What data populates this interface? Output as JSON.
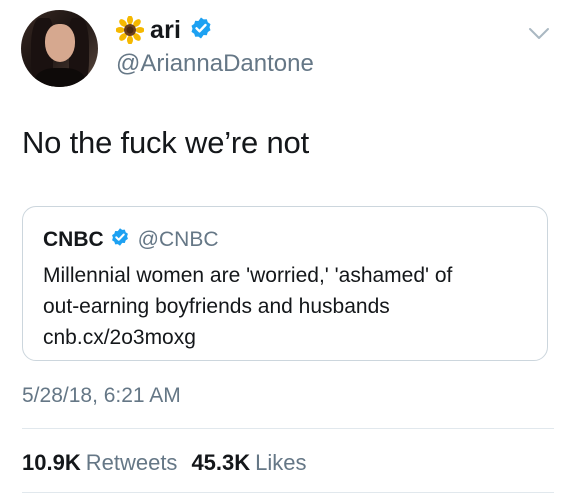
{
  "author": {
    "display_name": "ari",
    "handle": "@AriannaDantone",
    "name_emoji": "sunflower-icon",
    "verified": true
  },
  "tweet": {
    "text": "No the fuck we’re not",
    "timestamp": "5/28/18, 6:21 AM"
  },
  "quoted_tweet": {
    "display_name": "CNBC",
    "handle": "@CNBC",
    "verified": true,
    "lines": [
      "Millennial women are 'worried,' 'ashamed' of",
      "out-earning boyfriends and husbands",
      "cnb.cx/2o3moxg"
    ]
  },
  "stats": {
    "retweets_count": "10.9K",
    "retweets_label": "Retweets",
    "likes_count": "45.3K",
    "likes_label": "Likes"
  },
  "colors": {
    "verified_blue": "#1da1f2",
    "secondary_text": "#657786",
    "border": "#ccd6dd"
  }
}
